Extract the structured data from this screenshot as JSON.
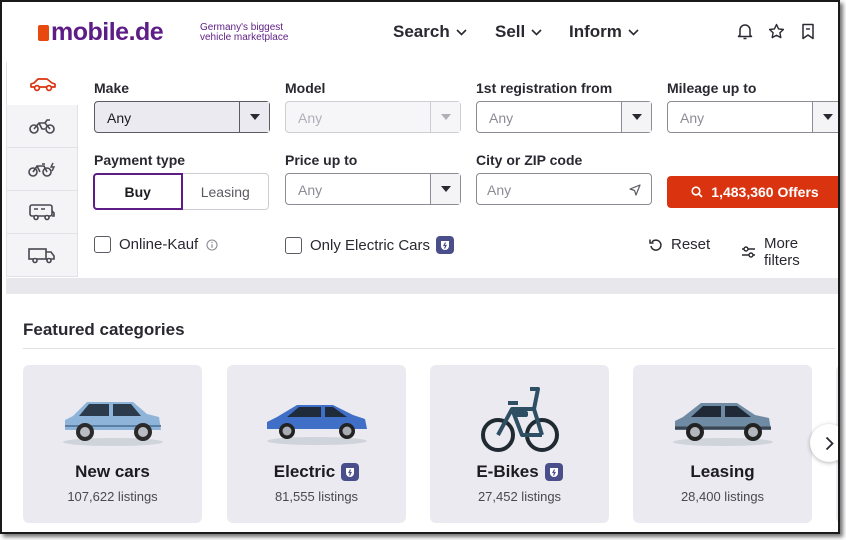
{
  "brand": {
    "name": "mobile.de",
    "tagline_line1": "Germany's biggest",
    "tagline_line2": "vehicle marketplace",
    "accent": "#5e1d86",
    "cta": "#d9340f"
  },
  "nav": [
    {
      "label": "Search"
    },
    {
      "label": "Sell"
    },
    {
      "label": "Inform"
    }
  ],
  "header_icons": [
    "bell-icon",
    "star-icon",
    "bookmark-icon"
  ],
  "vehicle_tabs": [
    "car-icon",
    "motorbike-icon",
    "e-bike-icon",
    "motorhome-icon",
    "truck-icon"
  ],
  "form": {
    "make": {
      "label": "Make",
      "value": "Any"
    },
    "model": {
      "label": "Model",
      "value": "Any"
    },
    "registration": {
      "label": "1st registration from",
      "value": "Any"
    },
    "mileage": {
      "label": "Mileage up to",
      "value": "Any"
    },
    "payment": {
      "label": "Payment type",
      "options": [
        "Buy",
        "Leasing"
      ],
      "selected": "Buy"
    },
    "price": {
      "label": "Price up to",
      "value": "Any"
    },
    "city": {
      "label": "City or ZIP code",
      "placeholder": "Any"
    },
    "offers_button": "1,483,360 Offers",
    "online_kauf": "Online-Kauf",
    "electric_only": "Only Electric Cars",
    "reset": "Reset",
    "more_filters": "More filters"
  },
  "featured": {
    "title": "Featured categories",
    "cards": [
      {
        "title": "New cars",
        "count": "107,622 listings"
      },
      {
        "title": "Electric",
        "count": "81,555 listings"
      },
      {
        "title": "E-Bikes",
        "count": "27,452 listings"
      },
      {
        "title": "Leasing",
        "count": "28,400 listings"
      }
    ]
  }
}
